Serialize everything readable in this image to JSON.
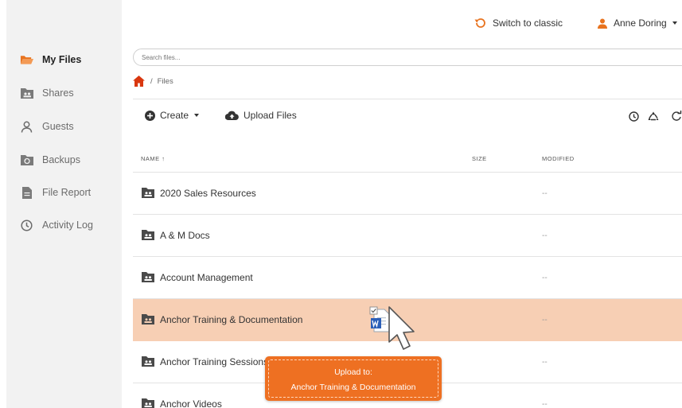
{
  "header": {
    "switch_classic": "Switch to classic",
    "user_name": "Anne Doring"
  },
  "sidebar": {
    "items": [
      {
        "label": "My Files",
        "icon": "folder-open-icon",
        "active": true
      },
      {
        "label": "Shares",
        "icon": "shared-folder-icon"
      },
      {
        "label": "Guests",
        "icon": "guest-user-icon"
      },
      {
        "label": "Backups",
        "icon": "backup-icon"
      },
      {
        "label": "File Report",
        "icon": "report-icon"
      },
      {
        "label": "Activity Log",
        "icon": "clock-icon"
      }
    ]
  },
  "search": {
    "placeholder": "Search files..."
  },
  "breadcrumb": {
    "separator": "/",
    "current": "Files"
  },
  "toolbar": {
    "create_label": "Create",
    "upload_label": "Upload Files"
  },
  "table": {
    "columns": {
      "name": "Name ↑",
      "size": "Size",
      "modified": "Modified"
    },
    "rows": [
      {
        "name": "2020 Sales Resources",
        "modified": "--"
      },
      {
        "name": "A & M Docs",
        "modified": "--"
      },
      {
        "name": "Account Management",
        "modified": "--"
      },
      {
        "name": "Anchor Training & Documentation",
        "modified": "--"
      },
      {
        "name": "Anchor Training Sessions",
        "modified": "--"
      },
      {
        "name": "Anchor Videos",
        "modified": "--"
      }
    ]
  },
  "drag_tooltip": {
    "line1": "Upload to:",
    "line2": "Anchor Training & Documentation"
  },
  "colors": {
    "accent": "#ee7022",
    "highlight_row": "#f7cfb4",
    "sidebar_bg": "#f2f2f2"
  }
}
